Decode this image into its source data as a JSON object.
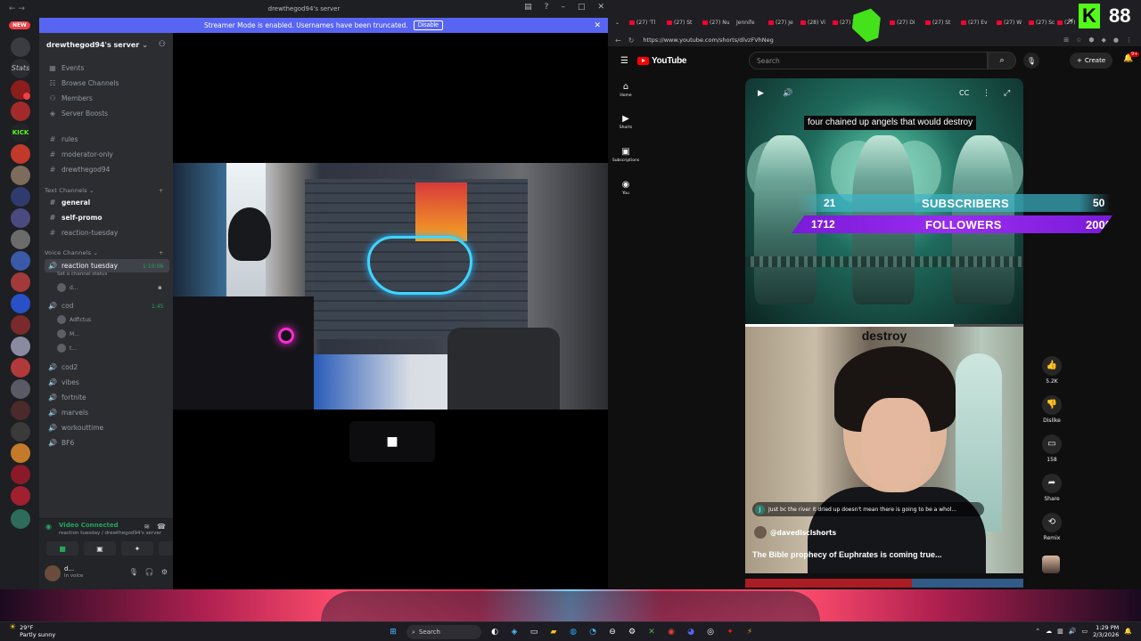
{
  "discord": {
    "window_title": "drewthegod94's server",
    "new_pill": "NEW",
    "banner": {
      "text": "Streamer Mode is enabled. Usernames have been truncated.",
      "button": "Disable"
    },
    "server_name": "drewthegod94's server",
    "menu": [
      "Events",
      "Browse Channels",
      "Members",
      "Server Boosts"
    ],
    "top_channels": [
      "rules",
      "moderator-only",
      "drewthegod94"
    ],
    "text_category": "Text Channels",
    "text_channels": [
      {
        "name": "general",
        "bold": true
      },
      {
        "name": "self-promo",
        "bold": true
      },
      {
        "name": "reaction-tuesday",
        "bold": false
      }
    ],
    "voice_category": "Voice Channels",
    "voice_channels": [
      {
        "name": "reaction tuesday",
        "timer": "1:10:06",
        "status": "Set a channel status",
        "users": [
          "d..."
        ]
      },
      {
        "name": "cod",
        "timer": "1:45",
        "users": [
          "Adfictus",
          "M...",
          "t..."
        ]
      },
      {
        "name": "cod2"
      },
      {
        "name": "vibes"
      },
      {
        "name": "fortnite"
      },
      {
        "name": "marvels"
      },
      {
        "name": "workouttime"
      },
      {
        "name": "BF6"
      }
    ],
    "voice_connected": {
      "title": "Video Connected",
      "subtitle": "reaction tuesday / drewthegod94's server"
    },
    "user": {
      "name": "d...",
      "status": "In voice"
    },
    "server_badges": [
      "6",
      "4",
      "4",
      "10",
      "1"
    ]
  },
  "browser": {
    "tabs": [
      "(27) 'Tl",
      "(27) St",
      "(27) Nu",
      "Jennife",
      "(27) Je",
      "(28) Vi",
      "(27) Tl",
      "(27) Di",
      "(27) St",
      "(27) Ev",
      "(27) W",
      "(27) Sc",
      "(27)"
    ],
    "url": "https://www.youtube.com/shorts/dlvzFVhNeg"
  },
  "kick": {
    "count": "88"
  },
  "youtube": {
    "logo": "YouTube",
    "search_placeholder": "Search",
    "create_label": "Create",
    "notif_badge": "9+",
    "sidebar": [
      {
        "icon": "home-icon",
        "label": "Home"
      },
      {
        "icon": "shorts-icon",
        "label": "Shorts"
      },
      {
        "icon": "subscriptions-icon",
        "label": "Subscriptions"
      },
      {
        "icon": "you-icon",
        "label": "You"
      }
    ],
    "short": {
      "caption_top": "four chained up angels that would destroy",
      "caption_bottom": "destroy",
      "progress_fraction": 0.75,
      "comment": {
        "initial": "J",
        "text": "Just bc the river it dried up doesn't mean there is going to be a whol..."
      },
      "channel": "@davedisclshorts",
      "title": "The Bible prophecy of Euphrates is coming true..."
    },
    "actions": [
      {
        "icon": "like-icon",
        "label": "5.2K"
      },
      {
        "icon": "dislike-icon",
        "label": "Dislike"
      },
      {
        "icon": "comment-icon",
        "label": "158"
      },
      {
        "icon": "share-icon",
        "label": "Share"
      },
      {
        "icon": "remix-icon",
        "label": "Remix"
      }
    ]
  },
  "stream_overlay": {
    "subs": {
      "current": "21",
      "label": "SUBSCRIBERS",
      "goal": "50"
    },
    "followers": {
      "current": "1712",
      "label": "FOLLOWERS",
      "goal": "2000"
    }
  },
  "taskbar": {
    "weather_temp": "29°F",
    "weather_desc": "Partly sunny",
    "search": "Search",
    "time": "1:29 PM",
    "date": "2/3/2026"
  }
}
